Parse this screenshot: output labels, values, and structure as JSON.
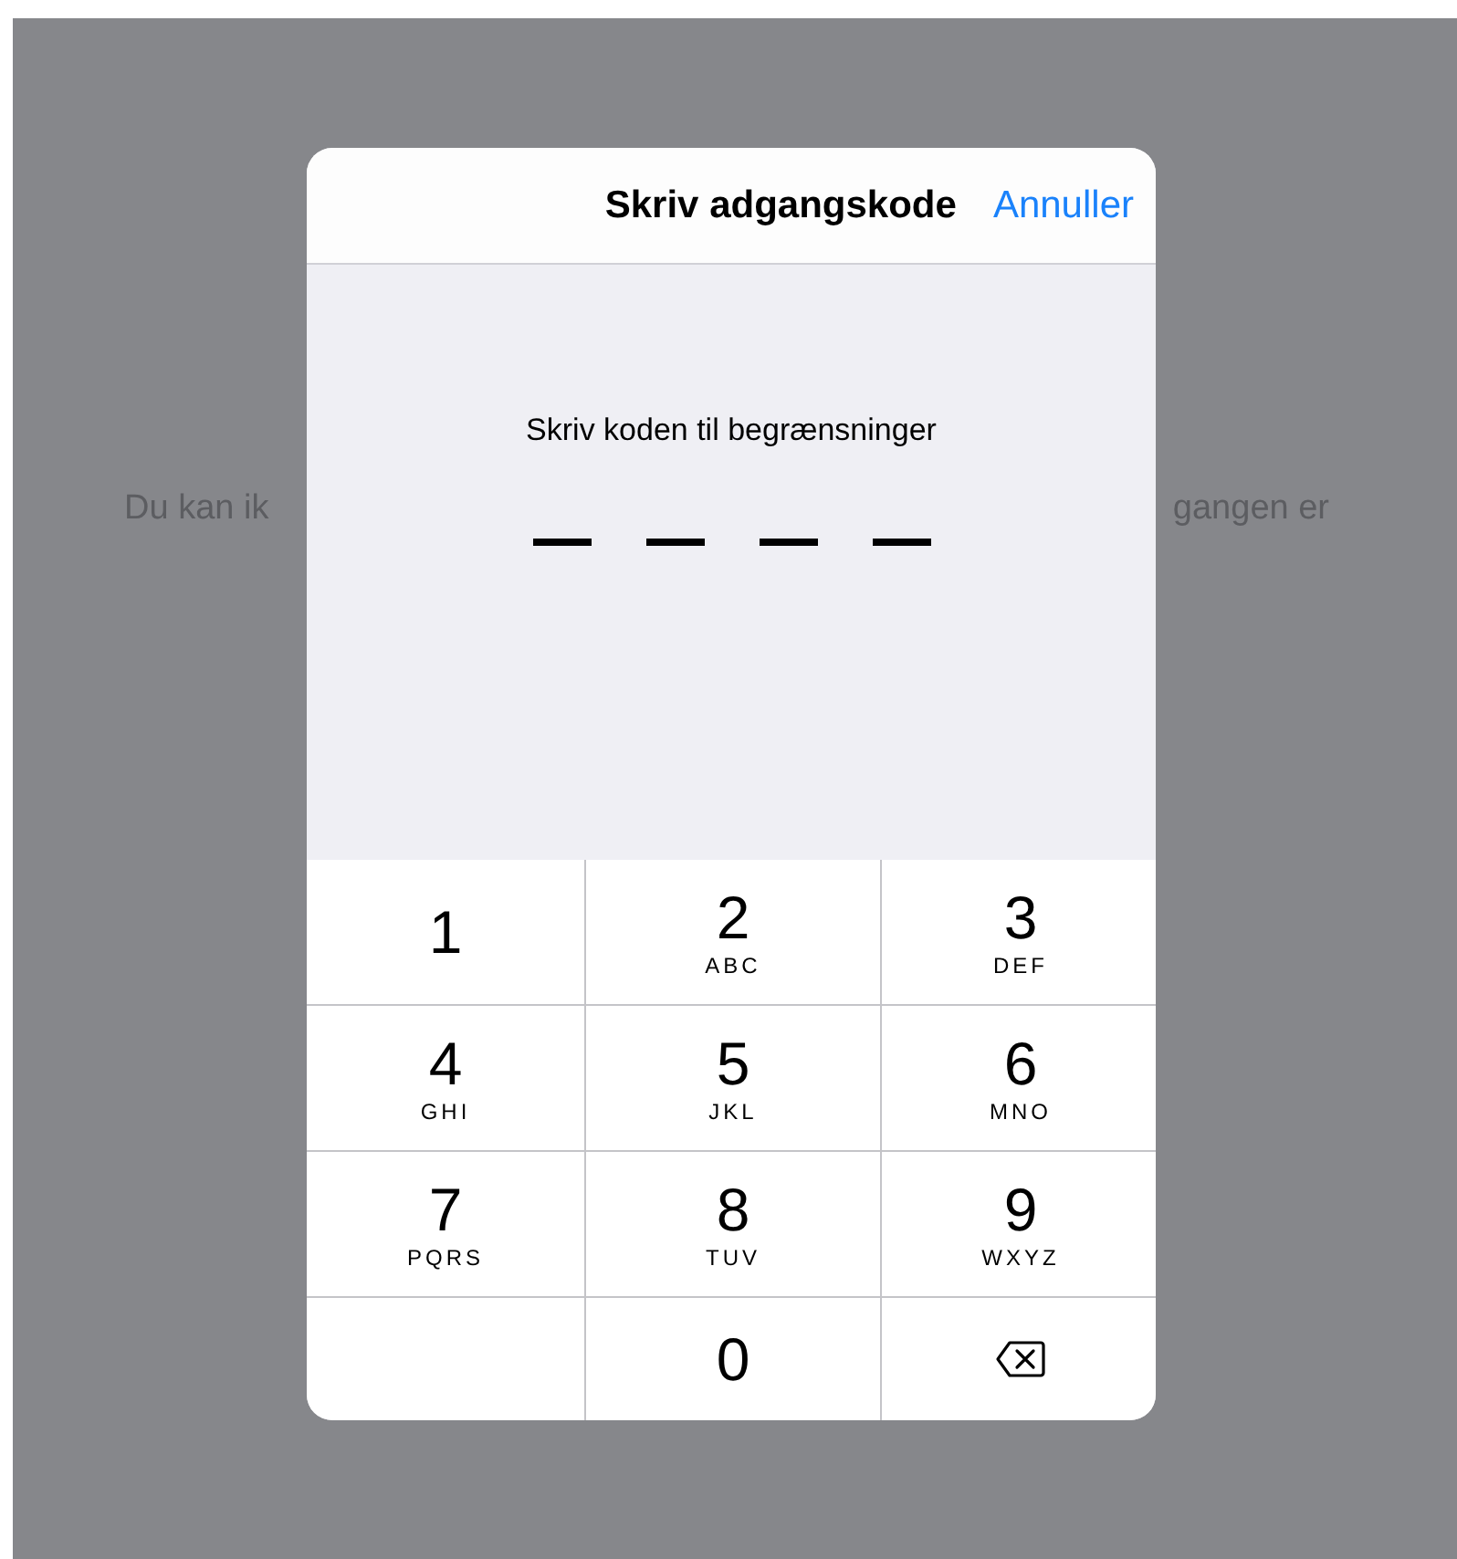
{
  "background": {
    "text_left": "Du kan ik",
    "text_right": "gangen er"
  },
  "dialog": {
    "title": "Skriv adgangskode",
    "cancel": "Annuller",
    "prompt": "Skriv koden til begrænsninger",
    "code_slots": [
      {
        "filled": false
      },
      {
        "filled": false
      },
      {
        "filled": false
      },
      {
        "filled": false
      }
    ],
    "keys": [
      {
        "kind": "digit",
        "digit": "1"
      },
      {
        "kind": "digit",
        "digit": "2",
        "letters": "ABC"
      },
      {
        "kind": "digit",
        "digit": "3",
        "letters": "DEF"
      },
      {
        "kind": "digit",
        "digit": "4",
        "letters": "GHI"
      },
      {
        "kind": "digit",
        "digit": "5",
        "letters": "JKL"
      },
      {
        "kind": "digit",
        "digit": "6",
        "letters": "MNO"
      },
      {
        "kind": "digit",
        "digit": "7",
        "letters": "PQRS"
      },
      {
        "kind": "digit",
        "digit": "8",
        "letters": "TUV"
      },
      {
        "kind": "digit",
        "digit": "9",
        "letters": "WXYZ"
      },
      {
        "kind": "blank"
      },
      {
        "kind": "digit",
        "digit": "0"
      },
      {
        "kind": "delete"
      }
    ]
  }
}
